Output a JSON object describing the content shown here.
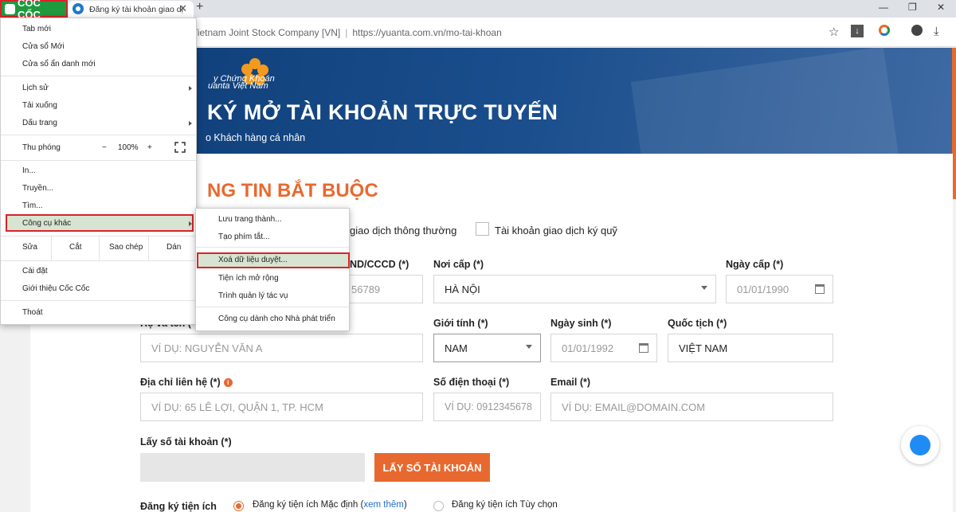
{
  "browser": {
    "brand": "CỐC CỐC",
    "tab_title": "Đăng ký tài khoản giao dị",
    "tab_close": "✕",
    "new_tab": "+",
    "win_min": "—",
    "win_restore": "❐",
    "win_close": "✕",
    "cert_name": "Vietnam Joint Stock Company [VN]",
    "url": "https://yuanta.com.vn/mo-tai-khoan",
    "toolbar_icons": [
      "star-icon",
      "download-page-icon",
      "coccoc-icon",
      "account-icon",
      "download-icon"
    ]
  },
  "banner": {
    "tagline_line1": "y Chứng Khoán",
    "tagline_line2": "uanta Việt Nam",
    "headline": "KÝ MỞ TÀI KHOẢN TRỰC TUYẾN",
    "subtitle": "o Khách hàng cá nhân"
  },
  "form": {
    "section_title": "NG TIN BẮT BUỘC",
    "account_type_partial": "giao dịch thông thường",
    "account_type_margin": "Tài khoản giao dịch ký quỹ",
    "id_label": "ND/CCCD (*)",
    "id_placeholder": "56789",
    "issue_place_label": "Nơi cấp (*)",
    "issue_place_value": "HÀ NỘI",
    "issue_date_label": "Ngày cấp (*)",
    "issue_date_placeholder": "01/01/1990",
    "fullname_label": "Họ và tên (*)",
    "fullname_placeholder": "VÍ DỤ: NGUYỄN VĂN A",
    "gender_label": "Giới tính (*)",
    "gender_value": "NAM",
    "dob_label": "Ngày sinh (*)",
    "dob_placeholder": "01/01/1992",
    "nationality_label": "Quốc tịch (*)",
    "nationality_value": "VIỆT NAM",
    "address_label": "Địa chỉ liên hệ (*)",
    "address_placeholder": "VÍ DỤ: 65 LÊ LỢI, QUẬN 1, TP. HCM",
    "phone_label": "Số điện thoại (*)",
    "phone_placeholder": "VÍ DỤ: 0912345678",
    "email_label": "Email (*)",
    "email_placeholder": "VÍ DỤ: EMAIL@DOMAIN.COM",
    "account_no_label": "Lấy số tài khoản (*)",
    "account_no_button": "LẤY SỐ TÀI KHOẢN",
    "utility_label": "Đăng ký tiện ích",
    "utility_default": "Đăng ký tiện ích Mặc định (",
    "utility_default_link": "xem thêm",
    "utility_default_close": ")",
    "utility_custom": "Đăng ký tiện ích Tùy chọn",
    "info_symbol": "i"
  },
  "menu": {
    "new_tab": "Tab mới",
    "new_window": "Cửa sổ Mới",
    "incognito": "Cửa sổ ẩn danh mới",
    "history": "Lịch sử",
    "downloads": "Tải xuống",
    "bookmarks": "Dấu trang",
    "zoom_label": "Thu phóng",
    "zoom_minus": "−",
    "zoom_value": "100%",
    "zoom_plus": "+",
    "print": "In...",
    "cast": "Truyền...",
    "find": "Tìm...",
    "more_tools": "Công cụ khác",
    "edit_label": "Sửa",
    "cut": "Cắt",
    "copy": "Sao chép",
    "paste": "Dán",
    "settings": "Cài đặt",
    "about": "Giới thiệu Cốc Cốc",
    "exit": "Thoát"
  },
  "submenu": {
    "save_page": "Lưu trang thành...",
    "create_shortcut": "Tạo phím tắt...",
    "clear_data": "Xoá dữ liệu duyệt...",
    "extensions": "Tiện ích mở rộng",
    "task_manager": "Trình quản lý tác vụ",
    "dev_tools": "Công cụ dành cho Nhà phát triển"
  }
}
